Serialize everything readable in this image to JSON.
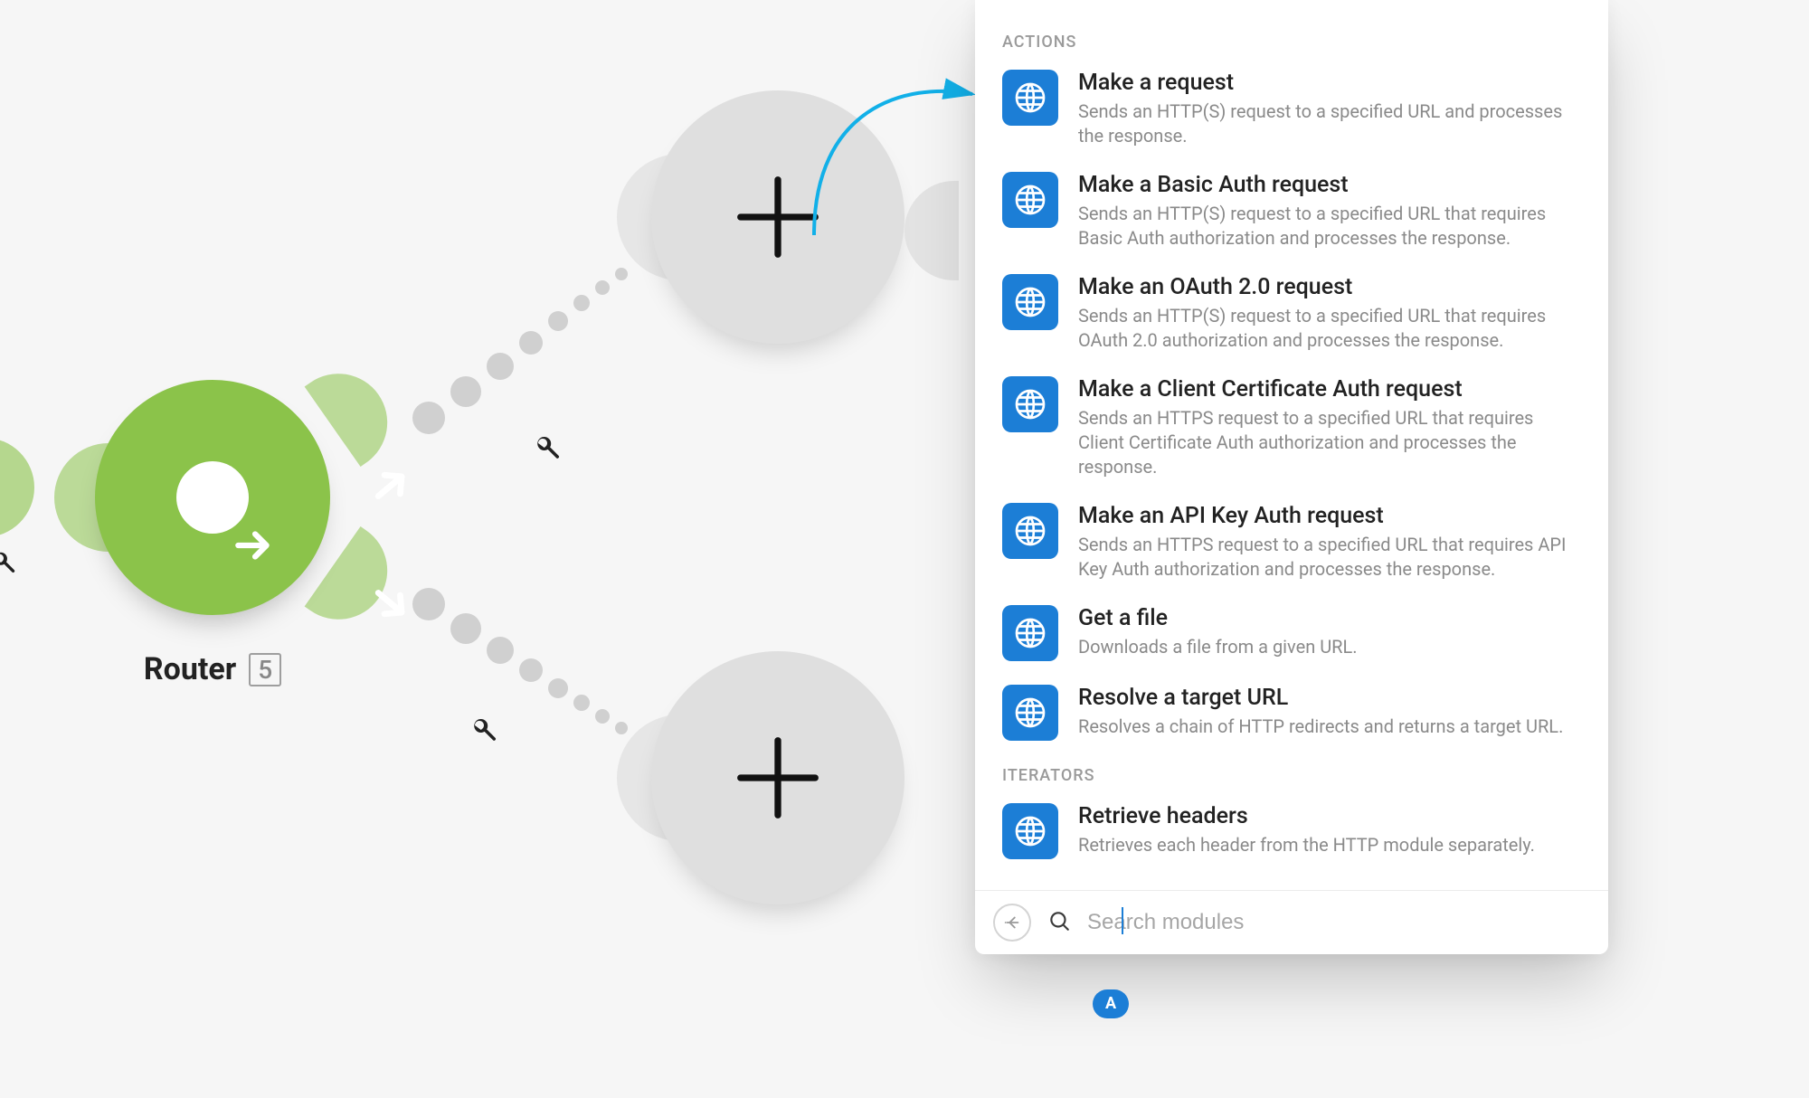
{
  "router": {
    "label": "Router",
    "badge": "5"
  },
  "panel": {
    "sections": [
      {
        "label": "ACTIONS",
        "items": [
          {
            "title": "Make a request",
            "desc": "Sends an HTTP(S) request to a specified URL and processes the response."
          },
          {
            "title": "Make a Basic Auth request",
            "desc": "Sends an HTTP(S) request to a specified URL that requires Basic Auth authorization and processes the response."
          },
          {
            "title": "Make an OAuth 2.0 request",
            "desc": "Sends an HTTP(S) request to a specified URL that requires OAuth 2.0 authorization and processes the response."
          },
          {
            "title": "Make a Client Certificate Auth request",
            "desc": "Sends an HTTPS request to a specified URL that requires Client Certificate Auth authorization and processes the response."
          },
          {
            "title": "Make an API Key Auth request",
            "desc": "Sends an HTTPS request to a specified URL that requires API Key Auth authorization and processes the response."
          },
          {
            "title": "Get a file",
            "desc": "Downloads a file from a given URL."
          },
          {
            "title": "Resolve a target URL",
            "desc": "Resolves a chain of HTTP redirects and returns a target URL."
          }
        ]
      },
      {
        "label": "ITERATORS",
        "items": [
          {
            "title": "Retrieve headers",
            "desc": "Retrieves each header from the HTTP module separately."
          }
        ]
      }
    ],
    "search_placeholder": "Search modules",
    "badge": "A"
  },
  "icons": {
    "http": "globe-icon"
  }
}
